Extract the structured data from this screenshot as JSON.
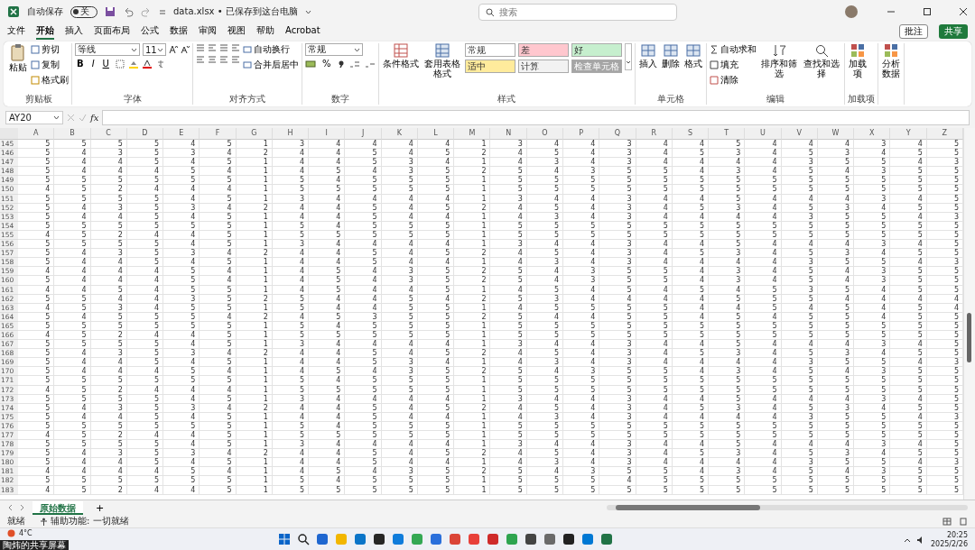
{
  "title_bar": {
    "autosave": {
      "label": "自动保存",
      "on": false,
      "state_text": "关"
    },
    "file_title": "data.xlsx • 已保存到这台电脑",
    "search": {
      "placeholder": "搜索"
    }
  },
  "menu_tabs": [
    {
      "label": "文件",
      "selected": false
    },
    {
      "label": "开始",
      "selected": true
    },
    {
      "label": "插入",
      "selected": false
    },
    {
      "label": "页面布局",
      "selected": false
    },
    {
      "label": "公式",
      "selected": false
    },
    {
      "label": "数据",
      "selected": false
    },
    {
      "label": "审阅",
      "selected": false
    },
    {
      "label": "视图",
      "selected": false
    },
    {
      "label": "帮助",
      "selected": false
    },
    {
      "label": "Acrobat",
      "selected": false
    }
  ],
  "menu_actions": {
    "comments": "批注",
    "share": "共享"
  },
  "ribbon": [
    {
      "kind": "clipboard",
      "label": "剪贴板",
      "paste": "粘贴",
      "actions": [
        "剪切",
        "复制",
        "格式刷"
      ]
    },
    {
      "kind": "font",
      "label": "字体",
      "font_name": "等线",
      "font_size": "11",
      "format_buttons": [
        "B",
        "I",
        "U"
      ]
    },
    {
      "kind": "alignment",
      "label": "对齐方式",
      "actions": [
        "自动换行",
        "合并后居中"
      ]
    },
    {
      "kind": "number",
      "label": "数字",
      "format": "常规",
      "buttons": [
        "%"
      ]
    },
    {
      "kind": "styles",
      "label": "样式",
      "commands": [
        "条件格式",
        "套用表格格式"
      ],
      "cells": [
        {
          "text": "常规",
          "color": "#ffffff"
        },
        {
          "text": "差",
          "color": "#ffc7ce"
        },
        {
          "text": "好",
          "color": "#c6efce"
        },
        {
          "text": "适中",
          "color": "#ffeb9c"
        },
        {
          "text": "计算",
          "color": "#f2f2f2"
        },
        {
          "text": "检查单元格",
          "color": "#a5a5a5"
        }
      ]
    },
    {
      "kind": "cells",
      "label": "单元格",
      "commands": [
        "插入",
        "删除",
        "格式"
      ]
    },
    {
      "kind": "editing",
      "label": "编辑",
      "actions": [
        "自动求和",
        "填充",
        "清除"
      ],
      "commands": [
        "排序和筛选",
        "查找和选择"
      ]
    },
    {
      "kind": "addins",
      "label": "加载项",
      "commands": [
        "加载项"
      ]
    },
    {
      "kind": "addins",
      "commands": [
        "分析数据"
      ]
    }
  ],
  "formula_bar": {
    "name_box": "AY20",
    "function_label": "fx"
  },
  "sheet": {
    "columns": [
      "A",
      "B",
      "C",
      "D",
      "E",
      "F",
      "G",
      "H",
      "I",
      "J",
      "K",
      "L",
      "M",
      "N",
      "O",
      "P",
      "Q",
      "R",
      "S",
      "T",
      "U",
      "V",
      "W",
      "X",
      "Y",
      "Z"
    ],
    "rows": [
      {
        "header": "145",
        "cells": [
          "5",
          "5",
          "5",
          "5",
          "4",
          "5",
          "1",
          "3",
          "4",
          "4",
          "4",
          "4",
          "1",
          "3",
          "4",
          "4",
          "3",
          "4",
          "4",
          "5",
          "4",
          "4",
          "4",
          "3",
          "4",
          "5"
        ]
      },
      {
        "header": "146",
        "cells": [
          "5",
          "4",
          "3",
          "5",
          "3",
          "4",
          "2",
          "4",
          "4",
          "5",
          "4",
          "5",
          "2",
          "4",
          "5",
          "4",
          "3",
          "4",
          "5",
          "3",
          "4",
          "5",
          "3",
          "4",
          "5",
          "5"
        ]
      },
      {
        "header": "147",
        "cells": [
          "5",
          "4",
          "4",
          "5",
          "4",
          "5",
          "1",
          "4",
          "4",
          "5",
          "3",
          "4",
          "1",
          "4",
          "3",
          "4",
          "3",
          "4",
          "4",
          "4",
          "4",
          "3",
          "5",
          "5",
          "4",
          "3"
        ]
      },
      {
        "header": "148",
        "cells": [
          "5",
          "4",
          "4",
          "4",
          "5",
          "4",
          "1",
          "4",
          "5",
          "4",
          "3",
          "5",
          "2",
          "5",
          "4",
          "3",
          "5",
          "5",
          "4",
          "3",
          "4",
          "5",
          "4",
          "3",
          "5",
          "5"
        ]
      },
      {
        "header": "149",
        "cells": [
          "5",
          "5",
          "5",
          "5",
          "5",
          "5",
          "1",
          "5",
          "4",
          "5",
          "5",
          "5",
          "1",
          "5",
          "5",
          "5",
          "5",
          "5",
          "5",
          "5",
          "5",
          "5",
          "5",
          "5",
          "5",
          "5"
        ]
      },
      {
        "header": "150",
        "cells": [
          "4",
          "5",
          "2",
          "4",
          "4",
          "4",
          "1",
          "5",
          "5",
          "5",
          "5",
          "5",
          "1",
          "5",
          "5",
          "5",
          "5",
          "5",
          "5",
          "5",
          "5",
          "5",
          "5",
          "5",
          "5",
          "5"
        ]
      },
      {
        "header": "151",
        "cells": [
          "5",
          "5",
          "5",
          "5",
          "4",
          "5",
          "1",
          "3",
          "4",
          "4",
          "4",
          "4",
          "1",
          "3",
          "4",
          "4",
          "3",
          "4",
          "4",
          "5",
          "4",
          "4",
          "4",
          "3",
          "4",
          "5"
        ]
      },
      {
        "header": "152",
        "cells": [
          "5",
          "4",
          "3",
          "5",
          "3",
          "4",
          "2",
          "4",
          "4",
          "5",
          "4",
          "5",
          "2",
          "4",
          "5",
          "4",
          "3",
          "4",
          "5",
          "3",
          "4",
          "5",
          "3",
          "4",
          "5",
          "5"
        ]
      },
      {
        "header": "153",
        "cells": [
          "5",
          "4",
          "4",
          "5",
          "4",
          "5",
          "1",
          "4",
          "4",
          "5",
          "4",
          "4",
          "1",
          "4",
          "3",
          "4",
          "3",
          "4",
          "4",
          "4",
          "4",
          "3",
          "5",
          "5",
          "4",
          "3"
        ]
      },
      {
        "header": "154",
        "cells": [
          "5",
          "5",
          "5",
          "5",
          "5",
          "5",
          "1",
          "5",
          "4",
          "5",
          "5",
          "5",
          "1",
          "5",
          "5",
          "5",
          "5",
          "5",
          "5",
          "5",
          "5",
          "5",
          "5",
          "5",
          "5",
          "5"
        ]
      },
      {
        "header": "155",
        "cells": [
          "4",
          "5",
          "2",
          "4",
          "4",
          "5",
          "1",
          "5",
          "5",
          "5",
          "5",
          "5",
          "1",
          "5",
          "5",
          "5",
          "5",
          "5",
          "5",
          "5",
          "5",
          "5",
          "5",
          "5",
          "5",
          "5"
        ]
      },
      {
        "header": "156",
        "cells": [
          "5",
          "5",
          "5",
          "5",
          "4",
          "5",
          "1",
          "3",
          "4",
          "4",
          "4",
          "4",
          "1",
          "3",
          "4",
          "4",
          "3",
          "4",
          "4",
          "5",
          "4",
          "4",
          "4",
          "3",
          "4",
          "5"
        ]
      },
      {
        "header": "157",
        "cells": [
          "5",
          "4",
          "3",
          "5",
          "3",
          "4",
          "2",
          "4",
          "4",
          "5",
          "4",
          "5",
          "2",
          "4",
          "5",
          "4",
          "3",
          "4",
          "5",
          "3",
          "4",
          "5",
          "3",
          "4",
          "5",
          "5"
        ]
      },
      {
        "header": "158",
        "cells": [
          "5",
          "4",
          "4",
          "5",
          "4",
          "5",
          "1",
          "4",
          "4",
          "5",
          "4",
          "4",
          "1",
          "4",
          "3",
          "4",
          "3",
          "4",
          "4",
          "4",
          "4",
          "3",
          "5",
          "5",
          "4",
          "3"
        ]
      },
      {
        "header": "159",
        "cells": [
          "4",
          "4",
          "4",
          "4",
          "5",
          "4",
          "1",
          "4",
          "5",
          "4",
          "3",
          "5",
          "2",
          "5",
          "4",
          "3",
          "5",
          "5",
          "4",
          "3",
          "4",
          "5",
          "4",
          "3",
          "5",
          "5"
        ]
      },
      {
        "header": "160",
        "cells": [
          "5",
          "4",
          "4",
          "4",
          "5",
          "4",
          "1",
          "4",
          "5",
          "4",
          "3",
          "5",
          "2",
          "5",
          "4",
          "3",
          "5",
          "5",
          "4",
          "3",
          "4",
          "5",
          "4",
          "3",
          "5",
          "5"
        ]
      },
      {
        "header": "161",
        "cells": [
          "4",
          "4",
          "5",
          "4",
          "5",
          "5",
          "1",
          "4",
          "5",
          "4",
          "4",
          "5",
          "1",
          "4",
          "5",
          "4",
          "5",
          "4",
          "5",
          "4",
          "5",
          "3",
          "5",
          "4",
          "5",
          "5"
        ]
      },
      {
        "header": "162",
        "cells": [
          "5",
          "5",
          "4",
          "4",
          "3",
          "5",
          "2",
          "5",
          "4",
          "4",
          "5",
          "4",
          "2",
          "5",
          "3",
          "4",
          "4",
          "4",
          "4",
          "5",
          "5",
          "5",
          "4",
          "4",
          "4",
          "4"
        ]
      },
      {
        "header": "163",
        "cells": [
          "4",
          "5",
          "3",
          "4",
          "5",
          "5",
          "1",
          "5",
          "4",
          "4",
          "5",
          "5",
          "1",
          "4",
          "5",
          "5",
          "5",
          "5",
          "4",
          "4",
          "5",
          "4",
          "5",
          "4",
          "5",
          "4"
        ]
      },
      {
        "header": "164",
        "cells": [
          "5",
          "4",
          "5",
          "5",
          "5",
          "4",
          "2",
          "4",
          "5",
          "3",
          "5",
          "5",
          "2",
          "5",
          "4",
          "4",
          "5",
          "5",
          "4",
          "5",
          "4",
          "5",
          "5",
          "4",
          "5",
          "5"
        ]
      },
      {
        "header": "165",
        "cells": [
          "5",
          "5",
          "5",
          "5",
          "5",
          "5",
          "1",
          "5",
          "4",
          "5",
          "5",
          "5",
          "1",
          "5",
          "5",
          "5",
          "5",
          "5",
          "5",
          "5",
          "5",
          "5",
          "5",
          "5",
          "5",
          "5"
        ]
      },
      {
        "header": "166",
        "cells": [
          "4",
          "5",
          "2",
          "4",
          "4",
          "5",
          "1",
          "5",
          "5",
          "5",
          "5",
          "5",
          "1",
          "5",
          "5",
          "5",
          "5",
          "5",
          "5",
          "5",
          "5",
          "5",
          "5",
          "5",
          "5",
          "5"
        ]
      },
      {
        "header": "167",
        "cells": [
          "5",
          "5",
          "5",
          "5",
          "4",
          "5",
          "1",
          "3",
          "4",
          "4",
          "4",
          "4",
          "1",
          "3",
          "4",
          "4",
          "3",
          "4",
          "4",
          "5",
          "4",
          "4",
          "4",
          "3",
          "4",
          "5"
        ]
      },
      {
        "header": "168",
        "cells": [
          "5",
          "4",
          "3",
          "5",
          "3",
          "4",
          "2",
          "4",
          "4",
          "5",
          "4",
          "5",
          "2",
          "4",
          "5",
          "4",
          "3",
          "4",
          "5",
          "3",
          "4",
          "5",
          "3",
          "4",
          "5",
          "5"
        ]
      },
      {
        "header": "169",
        "cells": [
          "5",
          "4",
          "4",
          "5",
          "4",
          "5",
          "1",
          "4",
          "4",
          "5",
          "3",
          "4",
          "1",
          "4",
          "3",
          "4",
          "3",
          "4",
          "4",
          "4",
          "4",
          "3",
          "5",
          "5",
          "4",
          "3"
        ]
      },
      {
        "header": "170",
        "cells": [
          "5",
          "4",
          "4",
          "4",
          "5",
          "4",
          "1",
          "4",
          "5",
          "4",
          "3",
          "5",
          "2",
          "5",
          "4",
          "3",
          "5",
          "5",
          "4",
          "3",
          "4",
          "5",
          "4",
          "3",
          "5",
          "5"
        ]
      },
      {
        "header": "171",
        "cells": [
          "5",
          "5",
          "5",
          "5",
          "5",
          "5",
          "1",
          "5",
          "4",
          "5",
          "5",
          "5",
          "1",
          "5",
          "5",
          "5",
          "5",
          "5",
          "5",
          "5",
          "5",
          "5",
          "5",
          "5",
          "5",
          "5"
        ]
      },
      {
        "header": "172",
        "cells": [
          "4",
          "5",
          "2",
          "4",
          "4",
          "4",
          "1",
          "5",
          "5",
          "5",
          "5",
          "5",
          "1",
          "5",
          "5",
          "5",
          "5",
          "5",
          "5",
          "5",
          "5",
          "5",
          "5",
          "5",
          "5",
          "5"
        ]
      },
      {
        "header": "173",
        "cells": [
          "5",
          "5",
          "5",
          "5",
          "4",
          "5",
          "1",
          "3",
          "4",
          "4",
          "4",
          "4",
          "1",
          "3",
          "4",
          "4",
          "3",
          "4",
          "4",
          "5",
          "4",
          "4",
          "4",
          "3",
          "4",
          "5"
        ]
      },
      {
        "header": "174",
        "cells": [
          "5",
          "4",
          "3",
          "5",
          "3",
          "4",
          "2",
          "4",
          "4",
          "5",
          "4",
          "5",
          "2",
          "4",
          "5",
          "4",
          "3",
          "4",
          "5",
          "3",
          "4",
          "5",
          "3",
          "4",
          "5",
          "5"
        ]
      },
      {
        "header": "175",
        "cells": [
          "5",
          "4",
          "4",
          "5",
          "4",
          "5",
          "1",
          "4",
          "4",
          "5",
          "4",
          "4",
          "1",
          "4",
          "3",
          "4",
          "3",
          "4",
          "4",
          "4",
          "4",
          "3",
          "5",
          "5",
          "4",
          "3"
        ]
      },
      {
        "header": "176",
        "cells": [
          "5",
          "5",
          "5",
          "5",
          "5",
          "5",
          "1",
          "5",
          "4",
          "5",
          "5",
          "5",
          "1",
          "5",
          "5",
          "5",
          "5",
          "5",
          "5",
          "5",
          "5",
          "5",
          "5",
          "5",
          "5",
          "5"
        ]
      },
      {
        "header": "177",
        "cells": [
          "4",
          "5",
          "2",
          "4",
          "4",
          "5",
          "1",
          "5",
          "5",
          "5",
          "5",
          "5",
          "1",
          "5",
          "5",
          "5",
          "5",
          "5",
          "5",
          "5",
          "5",
          "5",
          "5",
          "5",
          "5",
          "5"
        ]
      },
      {
        "header": "178",
        "cells": [
          "5",
          "5",
          "5",
          "5",
          "4",
          "5",
          "1",
          "3",
          "4",
          "4",
          "4",
          "4",
          "1",
          "3",
          "4",
          "4",
          "3",
          "4",
          "4",
          "5",
          "4",
          "4",
          "4",
          "3",
          "4",
          "5"
        ]
      },
      {
        "header": "179",
        "cells": [
          "5",
          "4",
          "3",
          "5",
          "3",
          "4",
          "2",
          "4",
          "4",
          "5",
          "4",
          "5",
          "2",
          "4",
          "5",
          "4",
          "3",
          "4",
          "5",
          "3",
          "4",
          "5",
          "3",
          "4",
          "5",
          "5"
        ]
      },
      {
        "header": "180",
        "cells": [
          "5",
          "4",
          "4",
          "5",
          "4",
          "5",
          "1",
          "4",
          "4",
          "5",
          "4",
          "4",
          "1",
          "4",
          "3",
          "4",
          "3",
          "4",
          "4",
          "4",
          "4",
          "3",
          "5",
          "5",
          "4",
          "3"
        ]
      },
      {
        "header": "181",
        "cells": [
          "4",
          "4",
          "4",
          "4",
          "5",
          "4",
          "1",
          "4",
          "5",
          "4",
          "3",
          "5",
          "2",
          "5",
          "4",
          "3",
          "5",
          "5",
          "4",
          "3",
          "4",
          "5",
          "4",
          "3",
          "5",
          "5"
        ]
      },
      {
        "header": "182",
        "cells": [
          "5",
          "5",
          "5",
          "5",
          "5",
          "5",
          "1",
          "5",
          "4",
          "5",
          "5",
          "5",
          "1",
          "5",
          "5",
          "5",
          "4",
          "5",
          "5",
          "5",
          "5",
          "5",
          "5",
          "5",
          "5",
          "5"
        ]
      },
      {
        "header": "183",
        "cells": [
          "4",
          "5",
          "2",
          "4",
          "4",
          "5",
          "1",
          "5",
          "5",
          "5",
          "5",
          "5",
          "1",
          "5",
          "5",
          "5",
          "5",
          "5",
          "5",
          "5",
          "5",
          "5",
          "5",
          "5",
          "5",
          "5"
        ]
      }
    ]
  },
  "sheet_tabs": [
    {
      "label": "原始数据",
      "selected": true
    }
  ],
  "add_sheet": "+",
  "status_bar": {
    "ready": "就绪",
    "accessibility": "辅助功能: 一切就绪"
  },
  "taskbar": {
    "weather": "4°C",
    "time": "20:25",
    "date": "2025/2/26"
  },
  "screen_share_label": "陶炜的共享屏幕"
}
